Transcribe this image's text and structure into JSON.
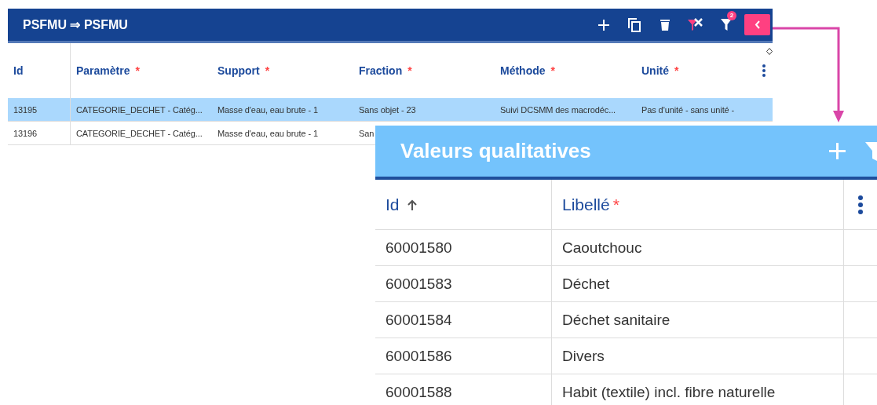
{
  "main_panel": {
    "title": "PSFMU ⇒ PSFMU",
    "filter_badge": "2",
    "columns": [
      {
        "label": "Id"
      },
      {
        "label": "Paramètre",
        "required_mark": "*"
      },
      {
        "label": "Support",
        "required_mark": "*"
      },
      {
        "label": "Fraction",
        "required_mark": "*"
      },
      {
        "label": "Méthode",
        "required_mark": "*"
      },
      {
        "label": "Unité",
        "required_mark": "*"
      }
    ],
    "rows": [
      {
        "selected": true,
        "cells": [
          "13195",
          "CATEGORIE_DECHET - Catég...",
          "Masse d'eau, eau brute - 1",
          "Sans objet - 23",
          "Suivi DCSMM des macrodéc...",
          "Pas d'unité - sans unité -"
        ]
      },
      {
        "selected": false,
        "cells": [
          "13196",
          "CATEGORIE_DECHET - Catég...",
          "Masse d'eau, eau brute - 1",
          "San"
        ]
      }
    ]
  },
  "detail_panel": {
    "title": "Valeurs qualitatives",
    "columns": [
      {
        "label": "Id",
        "sorted_ascending": true
      },
      {
        "label": "Libellé",
        "required_mark": "*"
      }
    ],
    "rows": [
      {
        "cells": [
          "60001580",
          "Caoutchouc"
        ]
      },
      {
        "cells": [
          "60001583",
          "Déchet"
        ]
      },
      {
        "cells": [
          "60001584",
          "Déchet sanitaire"
        ]
      },
      {
        "cells": [
          "60001586",
          "Divers"
        ]
      },
      {
        "cells": [
          "60001588",
          "Habit (textile) incl. fibre naturelle"
        ]
      }
    ]
  }
}
